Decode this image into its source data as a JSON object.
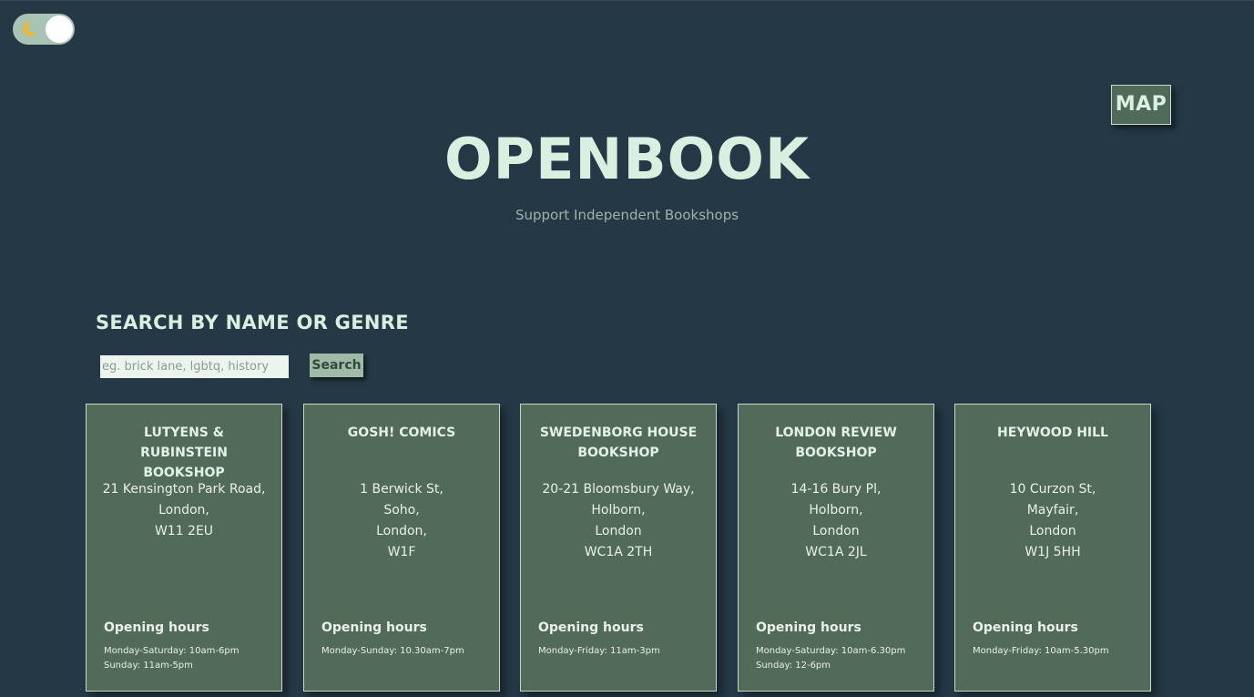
{
  "theme_toggle": {
    "icon": "moon-icon",
    "state": "dark"
  },
  "header": {
    "map_label": "MAP",
    "title": "OPENBOOK",
    "subtitle": "Support Independent Bookshops"
  },
  "search": {
    "heading": "SEARCH BY NAME OR GENRE",
    "placeholder": "eg. brick lane, lgbtq, history",
    "button_label": "Search"
  },
  "hours_label": "Opening hours",
  "shops": [
    {
      "name": "LUTYENS & RUBINSTEIN BOOKSHOP",
      "address": [
        "21 Kensington Park Road,",
        "London,",
        "W11 2EU"
      ],
      "hours": [
        "Monday-Saturday: 10am-6pm",
        "Sunday: 11am-5pm"
      ]
    },
    {
      "name": "GOSH! COMICS",
      "address": [
        "1 Berwick St,",
        "Soho,",
        "London,",
        "W1F"
      ],
      "hours": [
        "Monday-Sunday: 10.30am-7pm"
      ]
    },
    {
      "name": "SWEDENBORG HOUSE BOOKSHOP",
      "address": [
        "20-21 Bloomsbury Way,",
        "Holborn,",
        "London",
        "WC1A 2TH"
      ],
      "hours": [
        "Monday-Friday: 11am-3pm"
      ]
    },
    {
      "name": "LONDON REVIEW BOOKSHOP",
      "address": [
        "14-16 Bury Pl,",
        "Holborn,",
        "London",
        "WC1A 2JL"
      ],
      "hours": [
        "Monday-Saturday: 10am-6.30pm",
        "Sunday: 12-6pm"
      ]
    },
    {
      "name": "HEYWOOD HILL",
      "address": [
        "10 Curzon St,",
        "Mayfair,",
        "London",
        "W1J 5HH"
      ],
      "hours": [
        "Monday-Friday: 10am-5.30pm"
      ]
    }
  ],
  "colors": {
    "background": "#243845",
    "card": "#526a58",
    "accent": "#d9efe0",
    "moon": "#e8b93a"
  }
}
